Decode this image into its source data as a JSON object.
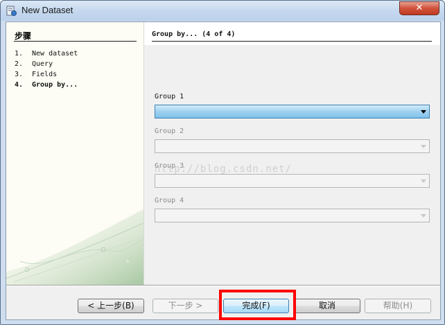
{
  "window": {
    "title": "New Dataset",
    "close_glyph": "✕"
  },
  "steps_panel": {
    "heading": "步骤",
    "items": [
      {
        "num": "1.",
        "label": "New dataset"
      },
      {
        "num": "2.",
        "label": "Query"
      },
      {
        "num": "3.",
        "label": "Fields"
      },
      {
        "num": "4.",
        "label": "Group by..."
      }
    ],
    "current_index": 3
  },
  "main": {
    "page_title": "Group by... (4 of 4)",
    "groups": [
      {
        "label": "Group 1",
        "value": "",
        "enabled": true
      },
      {
        "label": "Group 2",
        "value": "",
        "enabled": false
      },
      {
        "label": "Group 3",
        "value": "",
        "enabled": false
      },
      {
        "label": "Group 4",
        "value": "",
        "enabled": false
      }
    ],
    "watermark": "http://blog.csdn.net/"
  },
  "buttons": {
    "back": "< 上一步(B)",
    "next": "下一步 >",
    "finish": "完成(F)",
    "cancel": "取消",
    "help": "帮助(H)"
  },
  "colors": {
    "highlight_border": "#ff0000",
    "active_combo": "#9fd1ef"
  },
  "icons": [
    "app-icon",
    "close-icon",
    "dropdown-arrow-icon"
  ]
}
